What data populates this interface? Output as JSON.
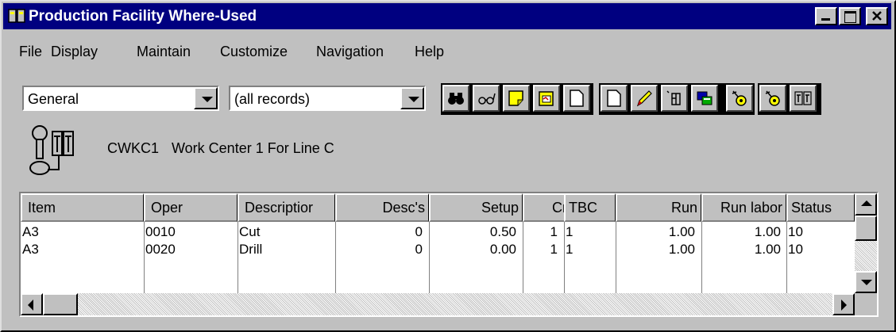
{
  "window": {
    "title": "Production Facility Where-Used",
    "minimize_label": "minimize",
    "maximize_label": "maximize",
    "close_label": "close"
  },
  "menu": [
    "File",
    "Display",
    "Maintain",
    "Customize",
    "Navigation",
    "Help"
  ],
  "filters": {
    "view": "General",
    "records": "(all records)"
  },
  "toolbar": {
    "icons": [
      "binoculars-icon",
      "glasses-icon",
      "note-icon",
      "print-preview-icon",
      "new-document-icon",
      "edit-pencil-icon",
      "facility-icon",
      "copy-records-icon",
      "settings-icon",
      "where-used-icon"
    ]
  },
  "workcenter": {
    "code": "CWKC1",
    "description": "Work Center 1 For Line C"
  },
  "grid": {
    "columns": [
      "Item",
      "Oper",
      "Descriptior",
      "Desc's",
      "Setup",
      "Crew",
      "TBC",
      "Run",
      "Run labor",
      "Status"
    ],
    "rows": [
      {
        "item": "A3",
        "oper": "0010",
        "description": "Cut",
        "descs": "0",
        "setup": "0.50",
        "crew": "1",
        "tbc": "1",
        "run": "1.00",
        "run_labor": "1.00",
        "status": "10"
      },
      {
        "item": "A3",
        "oper": "0020",
        "description": "Drill",
        "descs": "0",
        "setup": "0.00",
        "crew": "1",
        "tbc": "1",
        "run": "1.00",
        "run_labor": "1.00",
        "status": "10"
      }
    ]
  },
  "colors": {
    "titlebar": "#000080",
    "face": "#c0c0c0"
  }
}
